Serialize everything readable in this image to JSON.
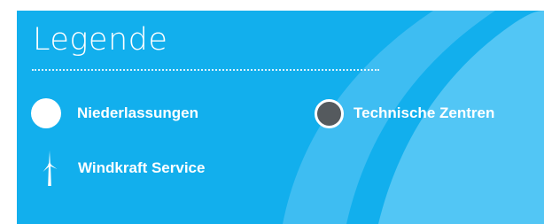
{
  "legend": {
    "title": "Legende",
    "items": [
      {
        "label": "Niederlassungen",
        "icon": "white-circle-icon"
      },
      {
        "label": "Technische Zentren",
        "icon": "grey-circle-icon"
      },
      {
        "label": "Windkraft Service",
        "icon": "wind-turbine-icon"
      }
    ]
  },
  "colors": {
    "background": "#12afed",
    "wave_light": "#3ebdf2",
    "wave_lighter": "#52c6f5",
    "text": "#ffffff",
    "dot_grey": "#555a5e"
  }
}
